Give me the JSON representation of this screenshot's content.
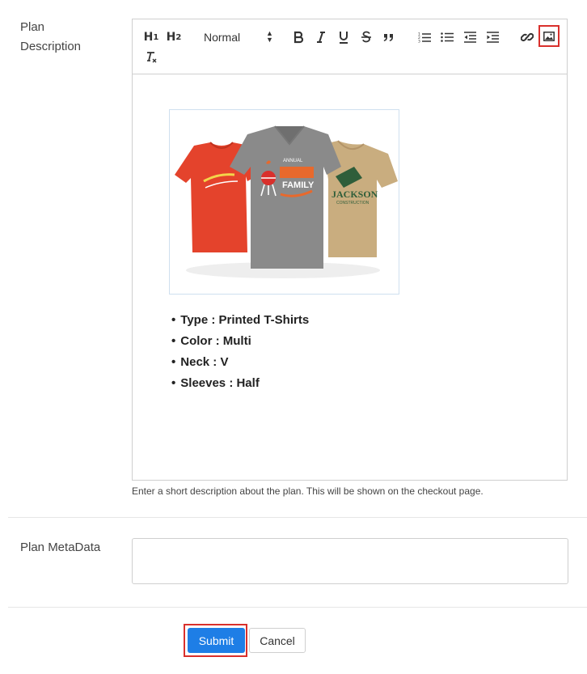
{
  "plan_description": {
    "label_line1": "Plan",
    "label_line2": "Description",
    "help_text": "Enter a short description about the plan. This will be shown on the checkout page."
  },
  "toolbar": {
    "h1": "H",
    "h1_sub": "1",
    "h2": "H",
    "h2_sub": "2",
    "format_select": "Normal",
    "icons": [
      "bold-icon",
      "italic-icon",
      "underline-icon",
      "strikethrough-icon",
      "blockquote-icon",
      "ordered-list-icon",
      "bullet-list-icon",
      "outdent-icon",
      "indent-icon",
      "link-icon",
      "image-icon",
      "clear-format-icon"
    ],
    "highlighted": "image-icon"
  },
  "content": {
    "image_alt": "Three T-shirts: red, grey, tan",
    "shirt_text": {
      "grey_top": "ANNUAL",
      "grey_main": "FAMILY",
      "tan_main": "JACKSON",
      "tan_sub": "CONSTRUCTION"
    },
    "bullets": [
      "Type : Printed T-Shirts",
      "Color : Multi",
      "Neck : V",
      "Sleeves : Half"
    ]
  },
  "plan_metadata": {
    "label": "Plan MetaData",
    "value": ""
  },
  "actions": {
    "submit_label": "Submit",
    "cancel_label": "Cancel"
  },
  "colors": {
    "primary": "#1e7ee6",
    "highlight": "#d9302c",
    "shirt_red": "#e4432c",
    "shirt_grey": "#8a8a8a",
    "shirt_tan": "#c9ad7f"
  }
}
